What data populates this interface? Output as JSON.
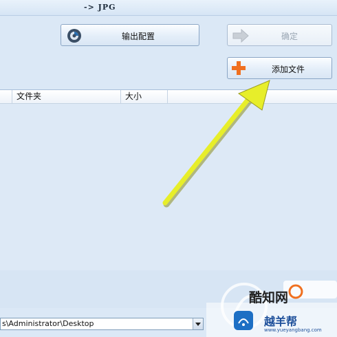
{
  "window": {
    "title": "-> JPG"
  },
  "buttons": {
    "output_config": "输出配置",
    "confirm": "确定",
    "add_file": "添加文件"
  },
  "table": {
    "columns": [
      "文件夹",
      "大小"
    ]
  },
  "path": {
    "value": "s\\Administrator\\Desktop"
  },
  "watermarks": {
    "brand1": "酷知网",
    "brand2": "越羊帮",
    "brand2_sub": "www.yueyangbang.com"
  },
  "colors": {
    "arrow": "#e7ee2a",
    "accent": "#f07020"
  }
}
